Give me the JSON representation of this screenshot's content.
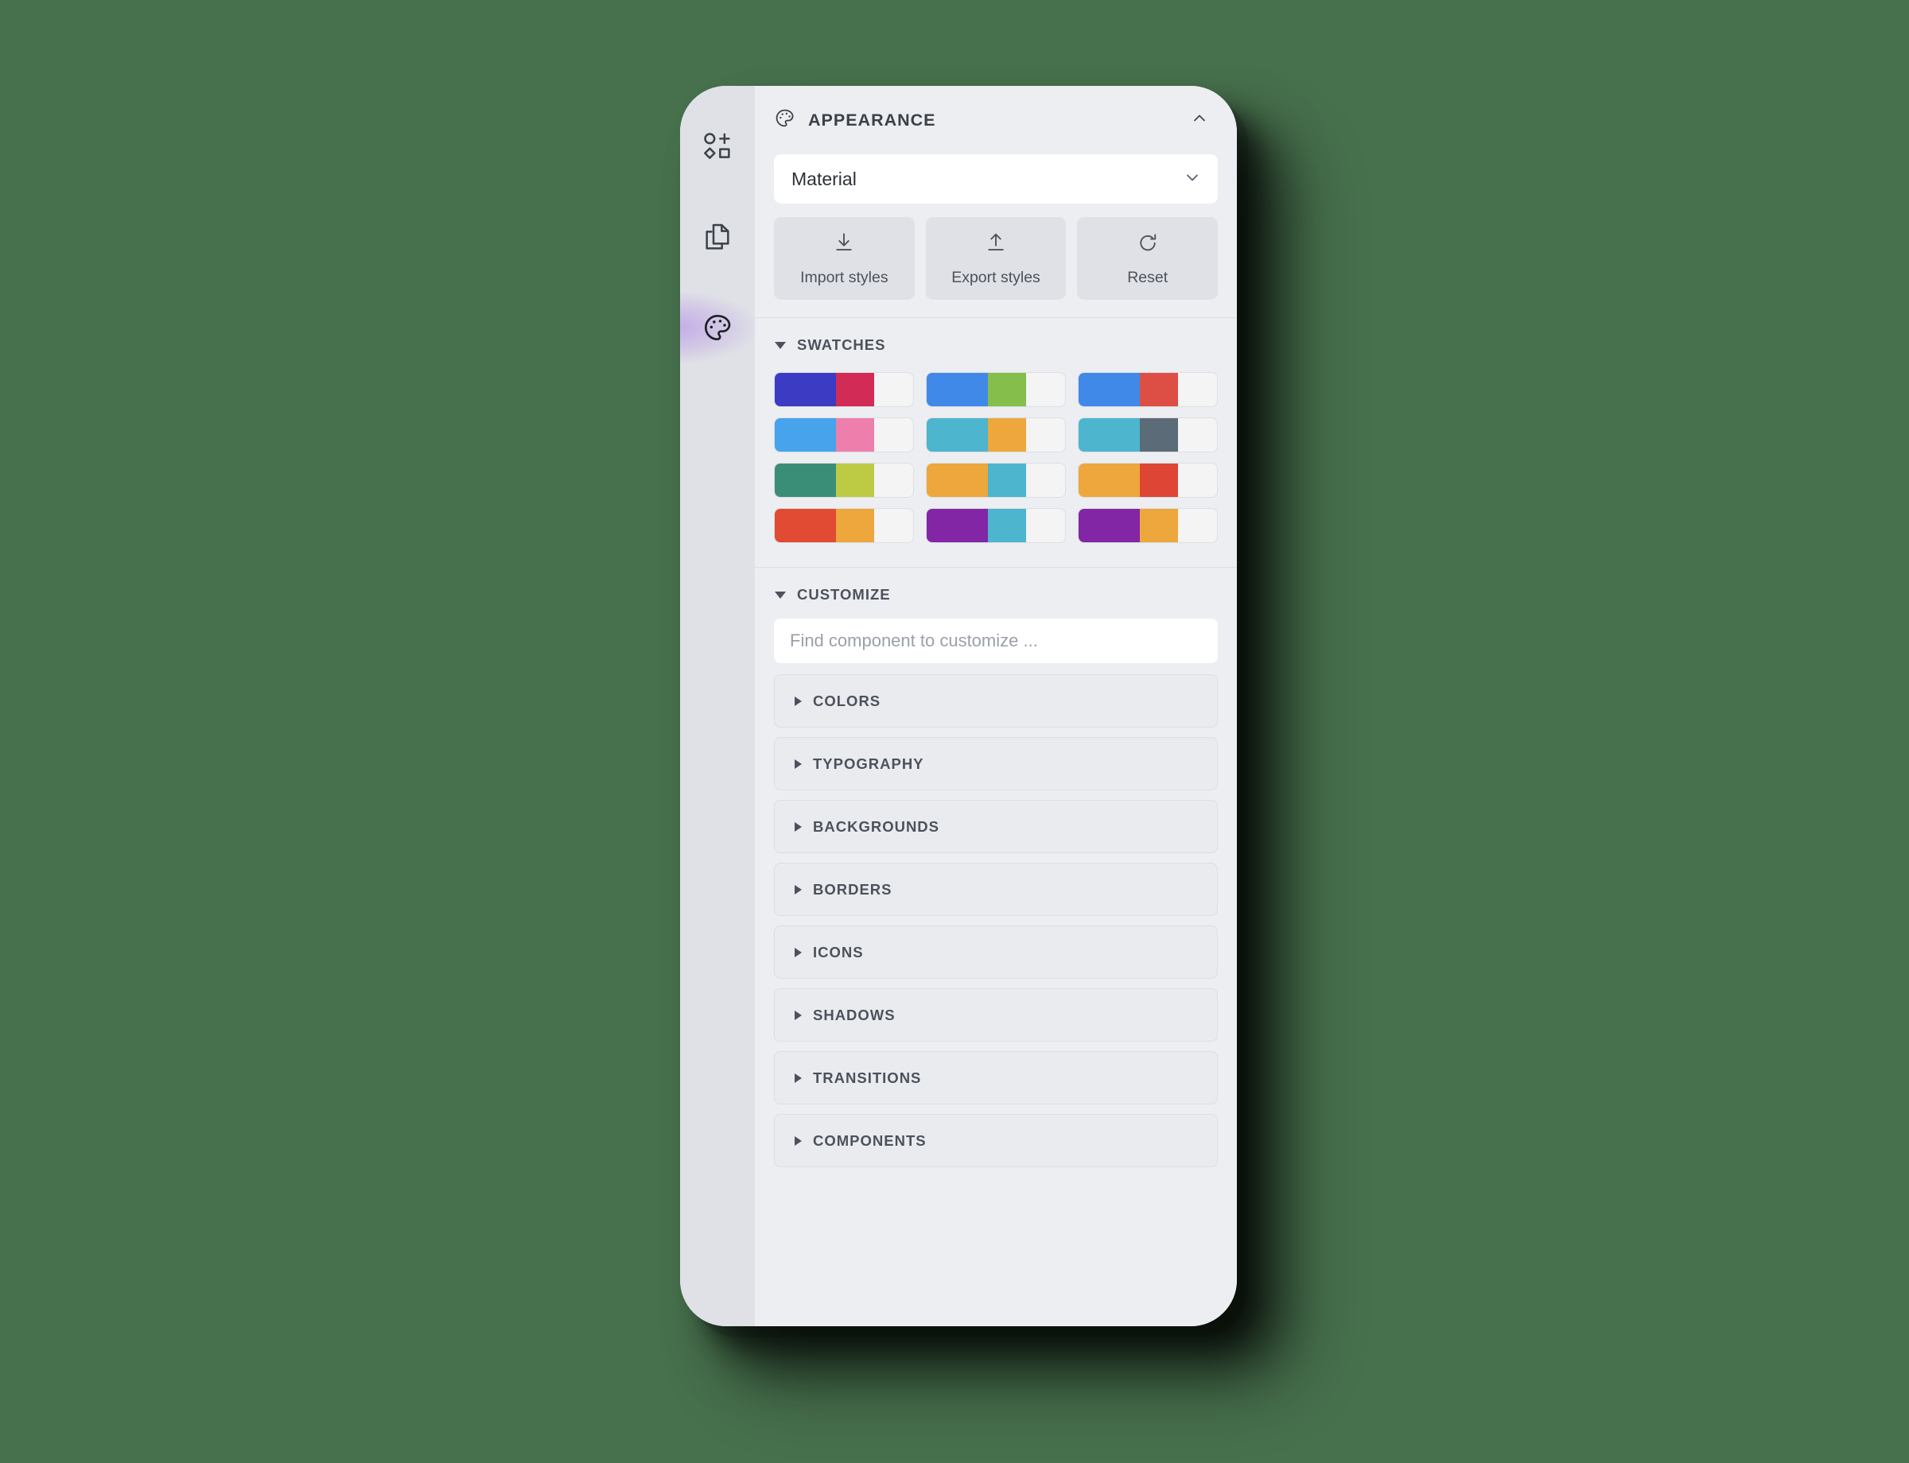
{
  "page": {
    "background_color": "#47704D"
  },
  "rail": {
    "items": [
      {
        "icon": "shapes-add-icon",
        "name": "components",
        "active": false
      },
      {
        "icon": "pages-copy-icon",
        "name": "pages",
        "active": false
      },
      {
        "icon": "palette-icon",
        "name": "appearance",
        "active": true
      }
    ],
    "active_indicator_color": "#8B3DE9"
  },
  "header": {
    "icon": "palette-icon",
    "title": "APPEARANCE",
    "collapse_icon": "chevron-up-icon"
  },
  "theme_select": {
    "value": "Material",
    "chevron_icon": "chevron-down-icon"
  },
  "actions": [
    {
      "label": "Import styles",
      "icon": "download-arrow-icon"
    },
    {
      "label": "Export styles",
      "icon": "upload-arrow-icon"
    },
    {
      "label": "Reset",
      "icon": "reset-rotate-icon"
    }
  ],
  "swatches_section": {
    "label": "SWATCHES",
    "expanded": true,
    "items": [
      {
        "colors": [
          "#3B3BC4",
          "#D22B56",
          "#F4F4F5"
        ]
      },
      {
        "colors": [
          "#4189E8",
          "#85BE4B",
          "#F4F4F5"
        ]
      },
      {
        "colors": [
          "#4189E8",
          "#DD4F45",
          "#F4F4F5"
        ]
      },
      {
        "colors": [
          "#47A3EC",
          "#EE7FAC",
          "#F4F4F5"
        ]
      },
      {
        "colors": [
          "#4DB5CE",
          "#EEA73C",
          "#F4F4F5"
        ]
      },
      {
        "colors": [
          "#4DB5CE",
          "#5B6B77",
          "#F4F4F5"
        ]
      },
      {
        "colors": [
          "#3A8E78",
          "#BCCB43",
          "#F4F4F5"
        ]
      },
      {
        "colors": [
          "#EEA73C",
          "#4DB5CE",
          "#F4F4F5"
        ]
      },
      {
        "colors": [
          "#EEA73C",
          "#DF4535",
          "#F4F4F5"
        ]
      },
      {
        "colors": [
          "#E14A33",
          "#EEA73C",
          "#F4F4F5"
        ]
      },
      {
        "colors": [
          "#8226A6",
          "#4DB5CE",
          "#F4F4F5"
        ]
      },
      {
        "colors": [
          "#8226A6",
          "#EEA73C",
          "#F4F4F5"
        ]
      }
    ]
  },
  "customize_section": {
    "label": "CUSTOMIZE",
    "expanded": true,
    "search_placeholder": "Find component to customize ...",
    "search_value": "",
    "groups": [
      {
        "label": "COLORS"
      },
      {
        "label": "TYPOGRAPHY"
      },
      {
        "label": "BACKGROUNDS"
      },
      {
        "label": "BORDERS"
      },
      {
        "label": "ICONS"
      },
      {
        "label": "SHADOWS"
      },
      {
        "label": "TRANSITIONS"
      },
      {
        "label": "COMPONENTS"
      }
    ]
  }
}
